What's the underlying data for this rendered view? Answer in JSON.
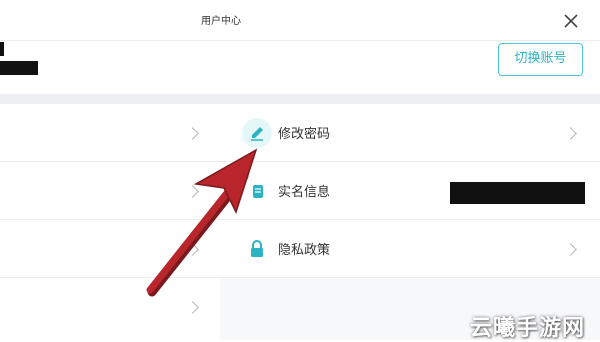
{
  "header": {
    "title": "用户中心",
    "switch_account_label": "切换账号"
  },
  "menu": {
    "items": [
      {
        "label": "修改密码",
        "icon": "pencil-icon"
      },
      {
        "label": "实名信息",
        "icon": "id-card-icon"
      },
      {
        "label": "隐私政策",
        "icon": "lock-icon"
      }
    ]
  },
  "watermark": "云曦手游网",
  "colors": {
    "accent": "#2bb3c4",
    "annotation_arrow": "#b8262b"
  }
}
